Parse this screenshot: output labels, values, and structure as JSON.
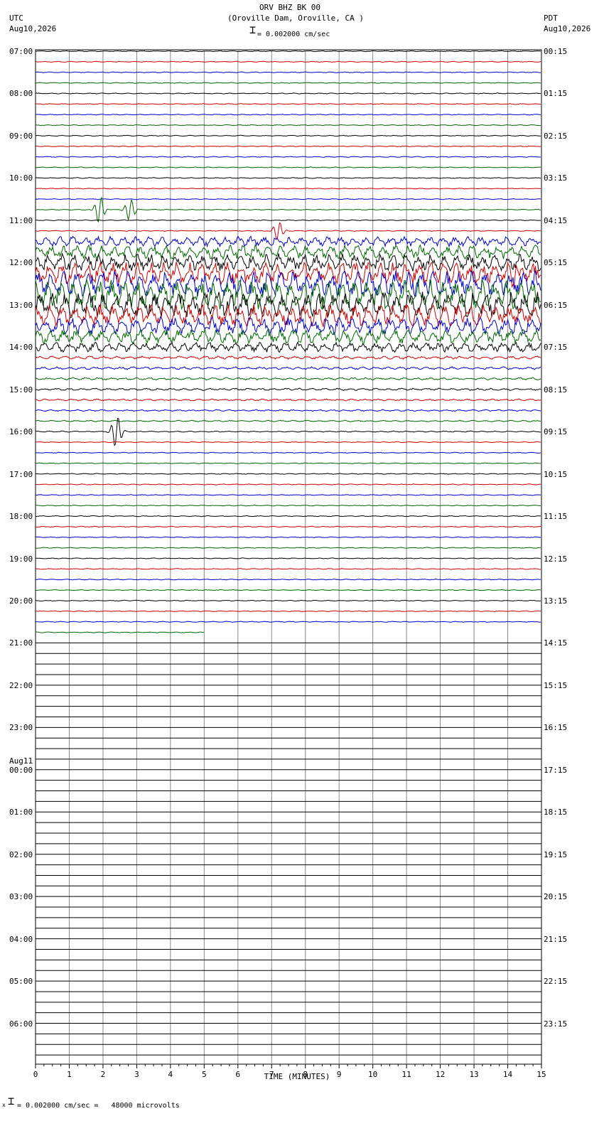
{
  "header": {
    "station_line": "ORV BHZ BK 00",
    "location_line": "(Oroville Dam, Oroville, CA )",
    "scale_line": "= 0.002000 cm/sec",
    "left_zone": "UTC",
    "left_date": "Aug10,2026",
    "right_zone": "PDT",
    "right_date": "Aug10,2026"
  },
  "footer": {
    "scale_note": "= 0.002000 cm/sec =   48000 microvolts",
    "marker": "x"
  },
  "chart_data": {
    "type": "line",
    "title": "ORV BHZ BK 00",
    "subtitle": "(Oroville Dam, Oroville, CA )",
    "xlabel": "TIME (MINUTES)",
    "x_ticks": [
      "0",
      "1",
      "2",
      "3",
      "4",
      "5",
      "6",
      "7",
      "8",
      "9",
      "10",
      "11",
      "12",
      "13",
      "14",
      "15"
    ],
    "xlim": [
      0,
      15
    ],
    "grid": true,
    "left_labels": [
      "07:00",
      "08:00",
      "09:00",
      "10:00",
      "11:00",
      "12:00",
      "13:00",
      "14:00",
      "15:00",
      "16:00",
      "17:00",
      "18:00",
      "19:00",
      "20:00",
      "21:00",
      "22:00",
      "23:00",
      "00:00",
      "01:00",
      "02:00",
      "03:00",
      "04:00",
      "05:00",
      "06:00"
    ],
    "date_change_label": "Aug11",
    "right_labels": [
      "00:15",
      "01:15",
      "02:15",
      "03:15",
      "04:15",
      "05:15",
      "06:15",
      "07:15",
      "08:15",
      "09:15",
      "10:15",
      "11:15",
      "12:15",
      "13:15",
      "14:15",
      "15:15",
      "16:15",
      "17:15",
      "18:15",
      "19:15",
      "20:15",
      "21:15",
      "22:15",
      "23:15"
    ],
    "traces_per_hour": 4,
    "trace_colors": [
      "#000000",
      "#cc0000",
      "#0000cc",
      "#006600"
    ],
    "active_traces": 56,
    "last_trace_end_minute": 5,
    "events": [
      {
        "trace": 15,
        "minute": 1.9,
        "amplitude": 20
      },
      {
        "trace": 15,
        "minute": 2.8,
        "amplitude": 16
      },
      {
        "trace": 17,
        "minute": 7.2,
        "amplitude": 14
      },
      {
        "trace": 21,
        "minute": 14.2,
        "amplitude": 16
      },
      {
        "trace": 36,
        "minute": 2.4,
        "amplitude": 24
      }
    ],
    "noisy_window": {
      "from_trace": 18,
      "to_trace": 28,
      "peak_amplitude": 18
    }
  }
}
